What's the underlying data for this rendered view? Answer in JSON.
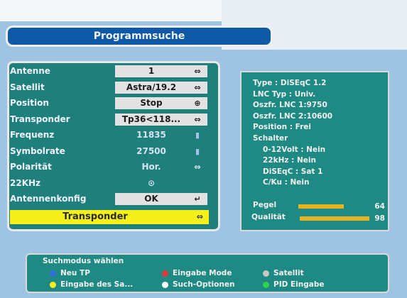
{
  "title": "Programmsuche",
  "rows": [
    {
      "label": "Antenne",
      "value": "1",
      "icon": "⇔"
    },
    {
      "label": "Satellit",
      "value": "Astra/19.2",
      "icon": "⇔"
    },
    {
      "label": "Position",
      "value": "Stop",
      "icon": "⊕"
    },
    {
      "label": "Transponder",
      "value": "Tp36<118...",
      "icon": "⇔"
    },
    {
      "label": "Frequenz",
      "value": "11835",
      "icon": "▮"
    },
    {
      "label": "Symbolrate",
      "value": "27500",
      "icon": "▮"
    },
    {
      "label": "Polarität",
      "value": "Hor.",
      "icon": "⇔"
    },
    {
      "label": "22KHz",
      "value": "⊙",
      "icon": ""
    },
    {
      "label": "Antennenkonfig",
      "value": "OK",
      "icon": "↵"
    }
  ],
  "transponder_button": {
    "label": "Transponder",
    "icon": "⇔"
  },
  "info": [
    "Type : DiSEqC 1.2",
    "LNC Typ : Univ.",
    "Oszfr. LNC 1:9750",
    "Oszfr. LNC 2:10600",
    "Position : Frei",
    "Schalter",
    "0-12Volt : Nein",
    "22kHz : Nein",
    "DiSEqC : Sat 1",
    "C/Ku : Nein"
  ],
  "meters": {
    "pegel": {
      "label": "Pegel",
      "value": "64",
      "fraction": 0.64
    },
    "qualitat": {
      "label": "Qualität",
      "value": "98",
      "fraction": 0.98
    }
  },
  "bottom": {
    "title": "Suchmodus wählen",
    "legend": [
      {
        "label": "Neu TP",
        "color": "#2f6fd8"
      },
      {
        "label": "Eingabe Mode",
        "color": "#e03a3a"
      },
      {
        "label": "Satellit",
        "color": "#c8c8c8"
      },
      {
        "label": "Eingabe des Sa...",
        "color": "#f5f01a"
      },
      {
        "label": "Such-Optionen",
        "color": "#ffffff"
      },
      {
        "label": "PID Eingabe",
        "color": "#2fd24a"
      }
    ]
  }
}
